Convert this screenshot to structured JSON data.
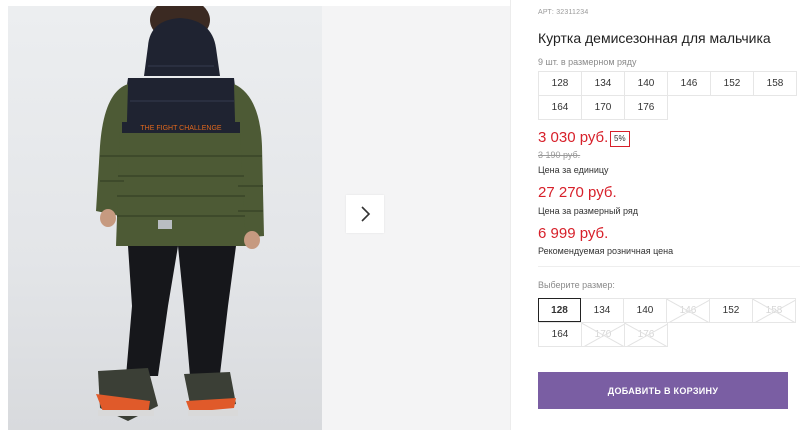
{
  "gallery": {
    "print_text": "THE FIGHT CHALLENGE",
    "next_icon": "chevron-right-icon"
  },
  "product": {
    "article": "АРТ: 32311234",
    "title": "Куртка демисезонная для мальчика",
    "qty_in_range": "9 шт. в размерном ряду",
    "range_sizes": [
      [
        "128",
        "134",
        "140",
        "146",
        "152",
        "158"
      ],
      [
        "164",
        "170",
        "176"
      ]
    ],
    "price": "3 030 руб.",
    "discount": "5%",
    "old_price": "3 190 руб.",
    "unit_label": "Цена за единицу",
    "range_price": "27 270 руб.",
    "range_label": "Цена за размерный ряд",
    "retail_price": "6 999 руб.",
    "retail_label": "Рекомендуемая розничная цена",
    "choose_size_label": "Выберите размер:",
    "select_sizes": [
      [
        {
          "label": "128",
          "state": "selected"
        },
        {
          "label": "134",
          "state": "available"
        },
        {
          "label": "140",
          "state": "available"
        },
        {
          "label": "146",
          "state": "disabled"
        },
        {
          "label": "152",
          "state": "available"
        },
        {
          "label": "158",
          "state": "disabled"
        }
      ],
      [
        {
          "label": "164",
          "state": "available"
        },
        {
          "label": "170",
          "state": "disabled"
        },
        {
          "label": "176",
          "state": "disabled"
        }
      ]
    ],
    "add_to_cart": "ДОБАВИТЬ В КОРЗИНУ"
  },
  "colors": {
    "accent_red": "#d7202a",
    "button_purple": "#7a5ea3",
    "jacket_green": "#4d5a35",
    "jacket_navy": "#1e2230"
  }
}
